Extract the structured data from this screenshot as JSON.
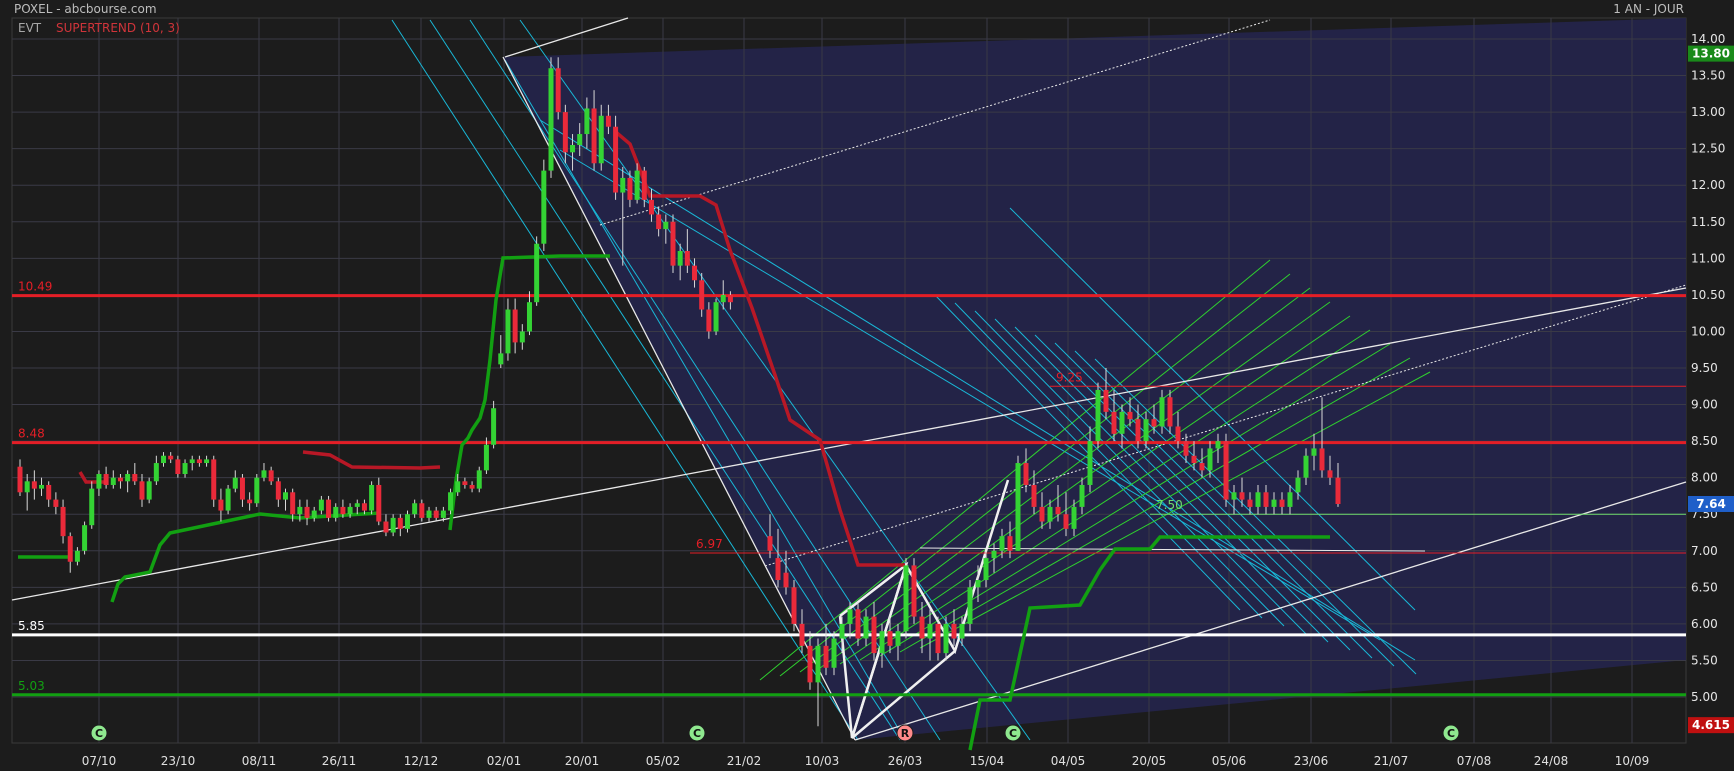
{
  "header": {
    "title": "POXEL - abcbourse.com",
    "period": "1 AN - JOUR",
    "indicator_prefix": "EVT",
    "indicator_name": "SUPERTREND (10, 3)"
  },
  "chart_data": {
    "type": "candlestick",
    "title": "POXEL - abcbourse.com",
    "period": "1 AN - JOUR",
    "ylim": [
      4.45,
      14.25
    ],
    "y_ticks": [
      "5.00",
      "5.50",
      "6.00",
      "6.50",
      "7.00",
      "7.50",
      "8.00",
      "8.50",
      "9.00",
      "9.50",
      "10.00",
      "10.50",
      "11.00",
      "11.50",
      "12.00",
      "12.50",
      "13.00",
      "13.50",
      "14.00"
    ],
    "x_ticks": [
      "07/10",
      "23/10",
      "08/11",
      "26/11",
      "12/12",
      "02/01",
      "20/01",
      "05/02",
      "21/02",
      "10/03",
      "26/03",
      "15/04",
      "04/05",
      "20/05",
      "05/06",
      "23/06",
      "21/07",
      "07/08",
      "24/08",
      "10/09"
    ],
    "last_price": "7.64",
    "axis_high": "13.80",
    "axis_low": "4.615",
    "levels": [
      {
        "label": "10.49",
        "value": 10.49,
        "color": "#e41e26"
      },
      {
        "label": "9.25",
        "value": 9.25,
        "color": "#e41e26"
      },
      {
        "label": "8.48",
        "value": 8.48,
        "color": "#e41e26"
      },
      {
        "label": "7.50",
        "value": 7.5,
        "color": "#6fdc6f"
      },
      {
        "label": "6.97",
        "value": 6.97,
        "color": "#e41e26"
      },
      {
        "label": "5.85",
        "value": 5.85,
        "color": "#ffffff"
      },
      {
        "label": "5.03",
        "value": 5.03,
        "color": "#12a012"
      }
    ],
    "events": [
      {
        "label": "C",
        "date": "07/10",
        "color": "#8fe88f"
      },
      {
        "label": "C",
        "date": "05/02",
        "color": "#8fe88f"
      },
      {
        "label": "R",
        "date": "26/03",
        "color": "#ff8a8a"
      },
      {
        "label": "C",
        "date": "15/04",
        "color": "#8fe88f"
      },
      {
        "label": "C",
        "date": "31/07",
        "color": "#8fe88f"
      }
    ],
    "candles": [
      [
        "02/10",
        8.15,
        8.25,
        7.75,
        7.8
      ],
      [
        "03/10",
        7.8,
        8.05,
        7.55,
        7.95
      ],
      [
        "04/10",
        7.95,
        8.1,
        7.7,
        7.85
      ],
      [
        "05/10",
        7.85,
        8.0,
        7.75,
        7.9
      ],
      [
        "06/10",
        7.9,
        7.95,
        7.6,
        7.7
      ],
      [
        "07/10",
        7.7,
        7.8,
        7.5,
        7.6
      ],
      [
        "08/10",
        7.6,
        7.7,
        7.1,
        7.2
      ],
      [
        "09/10",
        7.2,
        7.25,
        6.7,
        6.85
      ],
      [
        "10/10",
        6.85,
        7.05,
        6.8,
        7.0
      ],
      [
        "11/10",
        7.0,
        7.4,
        6.95,
        7.35
      ],
      [
        "12/10",
        7.35,
        7.95,
        7.3,
        7.85
      ],
      [
        "13/10",
        7.85,
        8.1,
        7.75,
        8.05
      ],
      [
        "14/10",
        8.05,
        8.15,
        7.85,
        7.9
      ],
      [
        "15/10",
        7.9,
        8.1,
        7.85,
        8.0
      ],
      [
        "16/10",
        8.0,
        8.05,
        7.85,
        7.95
      ],
      [
        "17/10",
        7.95,
        8.1,
        7.8,
        8.05
      ],
      [
        "18/10",
        8.05,
        8.2,
        7.9,
        7.95
      ],
      [
        "19/10",
        7.95,
        8.05,
        7.6,
        7.7
      ],
      [
        "20/10",
        7.7,
        8.0,
        7.65,
        7.95
      ],
      [
        "21/10",
        7.95,
        8.3,
        7.9,
        8.2
      ],
      [
        "22/10",
        8.2,
        8.35,
        8.15,
        8.3
      ],
      [
        "23/10",
        8.3,
        8.35,
        8.2,
        8.25
      ],
      [
        "24/10",
        8.25,
        8.3,
        8.0,
        8.05
      ],
      [
        "25/10",
        8.05,
        8.25,
        8.0,
        8.2
      ],
      [
        "26/10",
        8.2,
        8.3,
        8.1,
        8.25
      ],
      [
        "27/10",
        8.25,
        8.3,
        8.15,
        8.2
      ],
      [
        "28/10",
        8.2,
        8.3,
        8.15,
        8.25
      ],
      [
        "29/10",
        8.25,
        8.3,
        7.6,
        7.7
      ],
      [
        "30/10",
        7.7,
        7.85,
        7.4,
        7.55
      ],
      [
        "31/10",
        7.55,
        7.9,
        7.5,
        7.85
      ],
      [
        "01/11",
        7.85,
        8.1,
        7.8,
        8.0
      ],
      [
        "02/11",
        8.0,
        8.05,
        7.6,
        7.7
      ],
      [
        "03/11",
        7.7,
        7.8,
        7.55,
        7.65
      ],
      [
        "04/11",
        7.65,
        8.05,
        7.6,
        8.0
      ],
      [
        "05/11",
        8.0,
        8.2,
        7.95,
        8.1
      ],
      [
        "06/11",
        8.1,
        8.15,
        7.9,
        7.95
      ],
      [
        "07/11",
        7.95,
        8.0,
        7.6,
        7.7
      ],
      [
        "08/11",
        7.7,
        7.85,
        7.55,
        7.8
      ],
      [
        "09/11",
        7.8,
        7.85,
        7.4,
        7.5
      ],
      [
        "10/11",
        7.5,
        7.7,
        7.4,
        7.6
      ],
      [
        "11/11",
        7.6,
        7.7,
        7.35,
        7.45
      ],
      [
        "12/11",
        7.45,
        7.6,
        7.4,
        7.55
      ],
      [
        "13/11",
        7.55,
        7.75,
        7.5,
        7.7
      ],
      [
        "14/11",
        7.7,
        7.75,
        7.4,
        7.45
      ],
      [
        "15/11",
        7.45,
        7.65,
        7.4,
        7.6
      ],
      [
        "16/11",
        7.6,
        7.7,
        7.45,
        7.5
      ],
      [
        "17/11",
        7.5,
        7.65,
        7.45,
        7.6
      ],
      [
        "18/11",
        7.6,
        7.7,
        7.5,
        7.65
      ],
      [
        "19/11",
        7.65,
        7.7,
        7.5,
        7.55
      ],
      [
        "20/11",
        7.55,
        7.95,
        7.5,
        7.9
      ],
      [
        "21/11",
        7.9,
        8.0,
        7.35,
        7.4
      ],
      [
        "22/11",
        7.4,
        7.5,
        7.2,
        7.25
      ],
      [
        "23/11",
        7.25,
        7.5,
        7.2,
        7.45
      ],
      [
        "24/11",
        7.45,
        7.5,
        7.2,
        7.3
      ],
      [
        "25/11",
        7.3,
        7.55,
        7.25,
        7.5
      ],
      [
        "26/11",
        7.5,
        7.7,
        7.45,
        7.65
      ],
      [
        "27/11",
        7.65,
        7.7,
        7.4,
        7.45
      ],
      [
        "28/11",
        7.45,
        7.6,
        7.4,
        7.55
      ],
      [
        "29/11",
        7.55,
        7.6,
        7.4,
        7.45
      ],
      [
        "30/11",
        7.45,
        7.6,
        7.4,
        7.55
      ],
      [
        "01/12",
        7.55,
        7.85,
        7.5,
        7.8
      ],
      [
        "02/12",
        7.8,
        8.05,
        7.75,
        7.95
      ],
      [
        "03/12",
        7.95,
        8.0,
        7.85,
        7.9
      ],
      [
        "04/12",
        7.9,
        7.95,
        7.8,
        7.85
      ],
      [
        "05/12",
        7.85,
        8.15,
        7.8,
        8.1
      ],
      [
        "06/12",
        8.1,
        8.55,
        8.05,
        8.45
      ],
      [
        "07/12",
        8.45,
        9.05,
        8.4,
        8.95
      ],
      [
        "08/12",
        9.55,
        9.95,
        9.5,
        9.7
      ],
      [
        "09/12",
        9.7,
        10.45,
        9.6,
        10.3
      ],
      [
        "10/12",
        10.3,
        10.45,
        9.7,
        9.85
      ],
      [
        "11/12",
        9.85,
        10.1,
        9.75,
        10.0
      ],
      [
        "12/12",
        10.0,
        10.55,
        9.95,
        10.4
      ],
      [
        "13/12",
        10.4,
        11.3,
        10.35,
        11.2
      ],
      [
        "14/12",
        11.2,
        12.35,
        11.1,
        12.2
      ],
      [
        "15/12",
        12.2,
        13.75,
        12.1,
        13.6
      ],
      [
        "16/12",
        13.6,
        13.75,
        12.9,
        13.0
      ],
      [
        "17/12",
        13.0,
        13.1,
        12.3,
        12.45
      ],
      [
        "18/12",
        12.45,
        12.7,
        12.2,
        12.55
      ],
      [
        "19/12",
        12.55,
        12.85,
        12.4,
        12.7
      ],
      [
        "20/12",
        12.7,
        13.2,
        12.5,
        13.05
      ],
      [
        "21/12",
        13.05,
        13.3,
        12.2,
        12.3
      ],
      [
        "22/12",
        12.3,
        13.1,
        12.2,
        12.95
      ],
      [
        "23/12",
        12.95,
        13.1,
        12.7,
        12.8
      ],
      [
        "24/12",
        12.8,
        12.95,
        11.8,
        11.9
      ],
      [
        "25/12",
        11.9,
        12.25,
        10.9,
        12.1
      ],
      [
        "26/12",
        12.1,
        12.2,
        11.7,
        11.8
      ],
      [
        "27/12",
        11.8,
        12.3,
        11.75,
        12.2
      ],
      [
        "28/12",
        12.2,
        12.25,
        11.7,
        11.8
      ],
      [
        "29/12",
        11.8,
        11.95,
        11.5,
        11.6
      ],
      [
        "30/12",
        11.6,
        11.7,
        11.3,
        11.4
      ],
      [
        "31/12",
        11.4,
        11.6,
        11.2,
        11.5
      ],
      [
        "01/01",
        11.5,
        11.6,
        10.8,
        10.9
      ],
      [
        "02/01",
        10.9,
        11.2,
        10.7,
        11.1
      ],
      [
        "03/01",
        11.1,
        11.4,
        10.8,
        10.9
      ],
      [
        "04/01",
        10.9,
        11.0,
        10.6,
        10.7
      ],
      [
        "05/01",
        10.7,
        10.8,
        10.2,
        10.3
      ],
      [
        "06/01",
        10.3,
        10.4,
        9.9,
        10.0
      ],
      [
        "07/01",
        10.0,
        10.45,
        9.95,
        10.4
      ],
      [
        "08/01",
        10.4,
        10.7,
        10.3,
        10.5
      ],
      [
        "09/01",
        10.5,
        10.55,
        10.3,
        10.4
      ]
    ]
  }
}
